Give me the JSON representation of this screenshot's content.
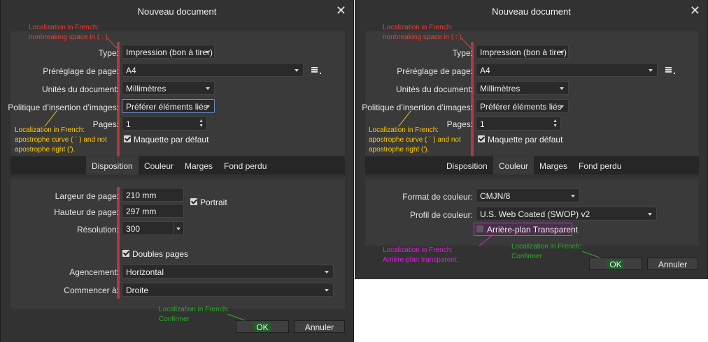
{
  "dialog1": {
    "title": "Nouveau document",
    "close_icon": "close-icon",
    "labels": {
      "type": "Type:",
      "preset": "Préréglage de page:",
      "units": "Unités du document:",
      "image_policy": "Politique d’insertion d’images:",
      "pages": "Pages:",
      "page_width": "Largeur de page:",
      "page_height": "Hauteur de page:",
      "resolution": "Résolution:",
      "arrangement": "Agencement:",
      "start_on": "Commencer à:"
    },
    "values": {
      "type": "Impression (bon à tirer)",
      "preset": "A4",
      "units": "Millimètres",
      "image_policy": "Préférer éléments liés",
      "pages": "1",
      "page_width": "210 mm",
      "page_height": "297 mm",
      "resolution": "300",
      "arrangement": "Horizontal",
      "start_on": "Droite"
    },
    "checkboxes": {
      "default_master": "Maquette par défaut",
      "portrait": "Portrait",
      "facing_pages": "Doubles pages"
    },
    "tabs": [
      "Disposition",
      "Couleur",
      "Marges",
      "Fond perdu"
    ],
    "selected_tab": "Disposition",
    "buttons": {
      "ok": "OK",
      "cancel": "Annuler"
    },
    "notes": {
      "nbsp": [
        "Localization in French:",
        "nonbreaking space in ( : )"
      ],
      "apostrophe": [
        "Localization in French:",
        "apostrophe curve ( ´ ) and not",
        "apostrophe right (')."
      ],
      "confirm": [
        "Localization in French:",
        "Confirmer"
      ]
    }
  },
  "dialog2": {
    "title": "Nouveau document",
    "close_icon": "close-icon",
    "labels": {
      "type": "Type:",
      "preset": "Préréglage de page:",
      "units": "Unités du document:",
      "image_policy": "Politique d’insertion d’images:",
      "pages": "Pages:",
      "color_format": "Format de couleur:",
      "color_profile": "Profil de couleur:"
    },
    "values": {
      "type": "Impression (bon à tirer)",
      "preset": "A4",
      "units": "Millimètres",
      "image_policy": "Préférer éléments liés",
      "pages": "1",
      "color_format": "CMJN/8",
      "color_profile": "U.S. Web Coated (SWOP) v2"
    },
    "checkboxes": {
      "default_master": "Maquette par défaut",
      "transparent_bg": "Arrière-plan Transparent"
    },
    "tabs": [
      "Disposition",
      "Couleur",
      "Marges",
      "Fond perdu"
    ],
    "selected_tab": "Couleur",
    "buttons": {
      "ok": "OK",
      "cancel": "Annuler"
    },
    "notes": {
      "nbsp": [
        "Localization in French:",
        "nonbreaking space in ( : )"
      ],
      "apostrophe": [
        "Localization in French:",
        "apostrophe curve ( ´ ) and not",
        "apostrophe right (')."
      ],
      "transparent": [
        "Localization in French:",
        "Arrière-plan transparent."
      ],
      "confirm": [
        "Localization in French:",
        "Confirmer"
      ]
    }
  },
  "colors": {
    "dialog_bg": "#323232",
    "panel_bg": "#3a3a3a",
    "note_red": "#e8413a",
    "note_yellow": "#ffcc00",
    "note_green": "#2eab2e",
    "note_magenta": "#e020e0"
  }
}
